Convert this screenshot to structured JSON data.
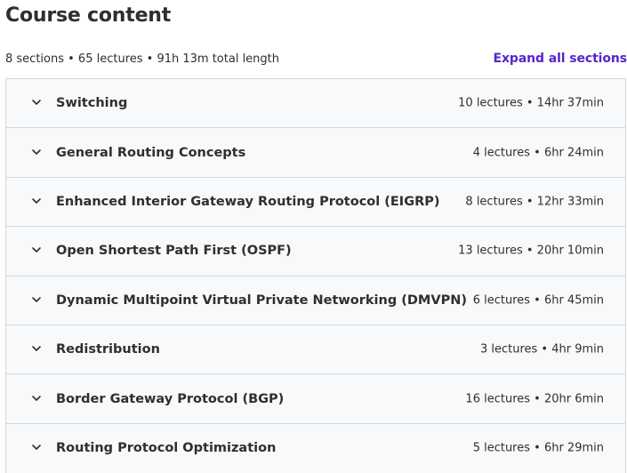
{
  "header": {
    "title": "Course content",
    "summary": "8 sections • 65 lectures • 91h 13m total length",
    "expand_label": "Expand all sections"
  },
  "colors": {
    "accent": "#5624d0",
    "section_bg": "#f7f9fa",
    "border": "#d1d7dc",
    "text": "#2d2f31"
  },
  "sections": [
    {
      "title": "Switching",
      "info": "10 lectures • 14hr 37min",
      "icon": "chevron-down-icon"
    },
    {
      "title": "General Routing Concepts",
      "info": "4 lectures • 6hr 24min",
      "icon": "chevron-down-icon"
    },
    {
      "title": "Enhanced Interior Gateway Routing Protocol (EIGRP)",
      "info": "8 lectures • 12hr 33min",
      "icon": "chevron-down-icon"
    },
    {
      "title": "Open Shortest Path First (OSPF)",
      "info": "13 lectures • 20hr 10min",
      "icon": "chevron-down-icon"
    },
    {
      "title": "Dynamic Multipoint Virtual Private Networking (DMVPN)",
      "info": "6 lectures • 6hr 45min",
      "icon": "chevron-down-icon"
    },
    {
      "title": "Redistribution",
      "info": "3 lectures • 4hr 9min",
      "icon": "chevron-down-icon"
    },
    {
      "title": "Border Gateway Protocol (BGP)",
      "info": "16 lectures • 20hr 6min",
      "icon": "chevron-down-icon"
    },
    {
      "title": "Routing Protocol Optimization",
      "info": "5 lectures • 6hr 29min",
      "icon": "chevron-down-icon"
    }
  ]
}
